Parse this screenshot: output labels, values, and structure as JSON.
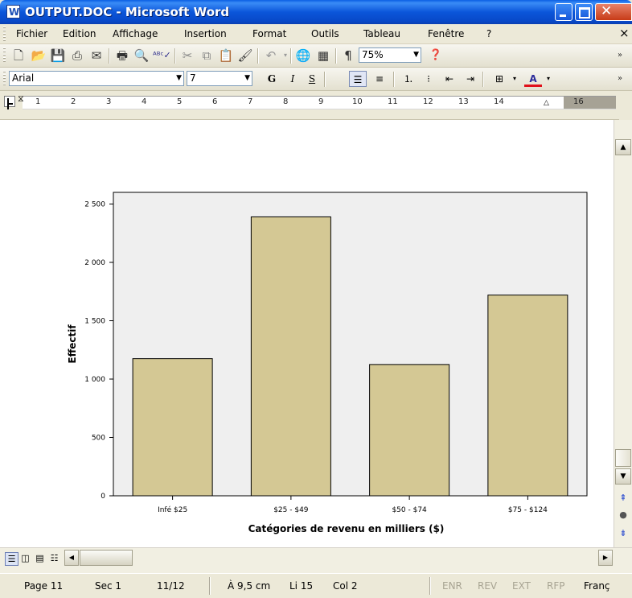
{
  "window": {
    "title": "OUTPUT.DOC - Microsoft Word",
    "app_icon": "word-doc-icon"
  },
  "menu": [
    "Fichier",
    "Edition",
    "Affichage",
    "Insertion",
    "Format",
    "Outils",
    "Tableau",
    "Fenêtre",
    "?"
  ],
  "menu_close": "×",
  "toolbar": {
    "zoom": "75%",
    "font": "Arial",
    "size": "7"
  },
  "format_buttons": {
    "bold": "G",
    "italic": "I",
    "underline": "S"
  },
  "ruler": {
    "labels": [
      "1",
      "2",
      "3",
      "4",
      "5",
      "6",
      "7",
      "8",
      "9",
      "10",
      "11",
      "12",
      "13",
      "14",
      "16"
    ]
  },
  "status": {
    "page": "Page 11",
    "section": "Sec 1",
    "pages": "11/12",
    "position": "À 9,5 cm",
    "line": "Li 15",
    "column": "Col 2",
    "enr": "ENR",
    "rev": "REV",
    "ext": "EXT",
    "rfp": "RFP",
    "language": "Franç"
  },
  "colors": {
    "bar_fill": "#D4C894",
    "plot_bg": "#EFEFEF",
    "title_bar": "#0A5FE3"
  },
  "chart_data": {
    "type": "bar",
    "categories": [
      "Infé $25",
      "$25 - $49",
      "$50 - $74",
      "$75 - $124"
    ],
    "values": [
      1175,
      2390,
      1125,
      1720
    ],
    "xlabel": "Catégories de revenu en milliers ($)",
    "ylabel": "Effectif",
    "ylim": [
      0,
      2600
    ],
    "yticks": [
      0,
      500,
      1000,
      1500,
      2000,
      2500
    ],
    "ytick_labels": [
      "0",
      "500",
      "1 000",
      "1 500",
      "2 000",
      "2 500"
    ],
    "grid": false,
    "legend": "none"
  }
}
